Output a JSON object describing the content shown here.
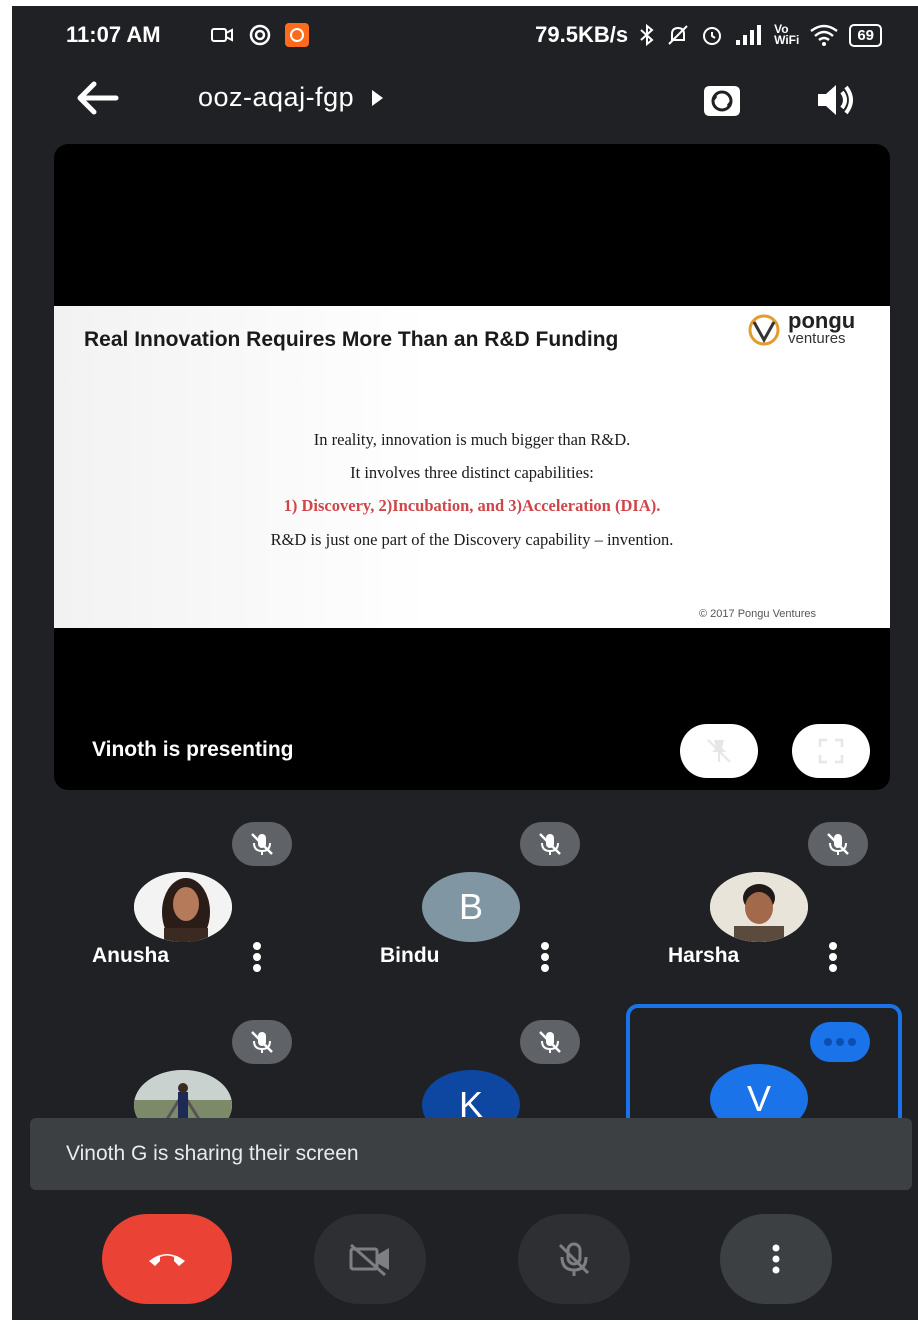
{
  "status_bar": {
    "time": "11:07 AM",
    "network_speed": "79.5KB/s",
    "volte_label": "Vo",
    "wifi_label": "WiFi",
    "battery": "69"
  },
  "header": {
    "meeting_code": "ooz-aqaj-fgp"
  },
  "presentation": {
    "slide": {
      "title": "Real Innovation Requires More Than an R&D Funding",
      "logo_line1": "pongu",
      "logo_line2": "ventures",
      "line1": "In reality, innovation is much bigger than R&D.",
      "line2": "It involves three distinct capabilities:",
      "line3": "1) Discovery, 2)Incubation, and 3)Acceleration (DIA).",
      "line4": "R&D is just one part of the Discovery capability – invention.",
      "copyright": "© 2017 Pongu Ventures"
    },
    "presenting_label": "Vinoth is presenting"
  },
  "participants": [
    {
      "name": "Anusha",
      "initial": "",
      "avatar_color": "#f5f5f5"
    },
    {
      "name": "Bindu",
      "initial": "B",
      "avatar_color": "#8196a3"
    },
    {
      "name": "Harsha",
      "initial": "",
      "avatar_color": "#e9e6e0"
    },
    {
      "name": "",
      "initial": "",
      "avatar_color": "#9aa59b"
    },
    {
      "name": "",
      "initial": "K",
      "avatar_color": "#0d47a1"
    },
    {
      "name": "",
      "initial": "V",
      "avatar_color": "#1a73e8"
    }
  ],
  "snackbar": {
    "message": "Vinoth G is sharing their screen"
  },
  "colors": {
    "background": "#202124",
    "end_call": "#ea4335",
    "accent": "#1a73e8"
  }
}
